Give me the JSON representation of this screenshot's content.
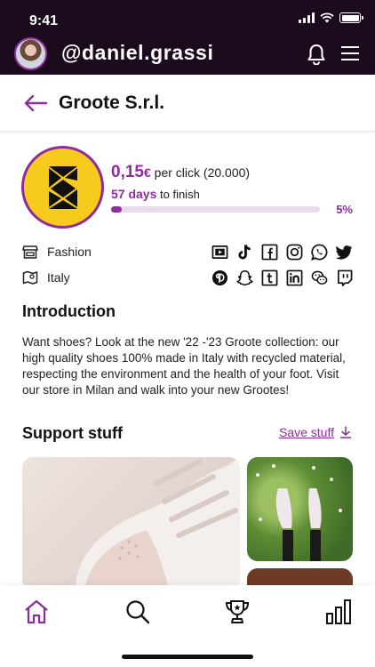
{
  "status_bar": {
    "time": "9:41"
  },
  "top_bar": {
    "username": "@daniel.grassi",
    "icons": [
      "avatar",
      "bell-icon",
      "menu-icon"
    ]
  },
  "header": {
    "title": "Groote S.r.l.",
    "back_icon": "arrow-left-icon"
  },
  "campaign": {
    "price": "0,15",
    "currency": "€",
    "price_suffix": "per click (20.000)",
    "days": "57 days",
    "days_suffix": "to finish",
    "progress_label": "5%",
    "progress_value": 0.05
  },
  "meta": {
    "category": "Fashion",
    "location": "Italy"
  },
  "social_icons": [
    "youtube-icon",
    "tiktok-icon",
    "facebook-icon",
    "instagram-icon",
    "whatsapp-icon",
    "twitter-icon",
    "pinterest-icon",
    "snapchat-icon",
    "tumblr-icon",
    "linkedin-icon",
    "wechat-icon",
    "twitch-icon"
  ],
  "introduction": {
    "title": "Introduction",
    "text": "Want shoes? Look at the new '22 -'23 Groote collection: our high quality shoes 100% made in Italy with recycled material, respecting the environment and the health of your foot. Visit our store in Milan and walk into your new Grootes!"
  },
  "support": {
    "title": "Support stuff",
    "save_label": "Save stuff"
  },
  "bottom_nav": [
    "home-icon",
    "search-icon",
    "trophy-icon",
    "stats-icon"
  ],
  "colors": {
    "accent": "#8e2c9e",
    "topbar": "#1c0b1d",
    "logo_bg": "#f7cb1d"
  }
}
